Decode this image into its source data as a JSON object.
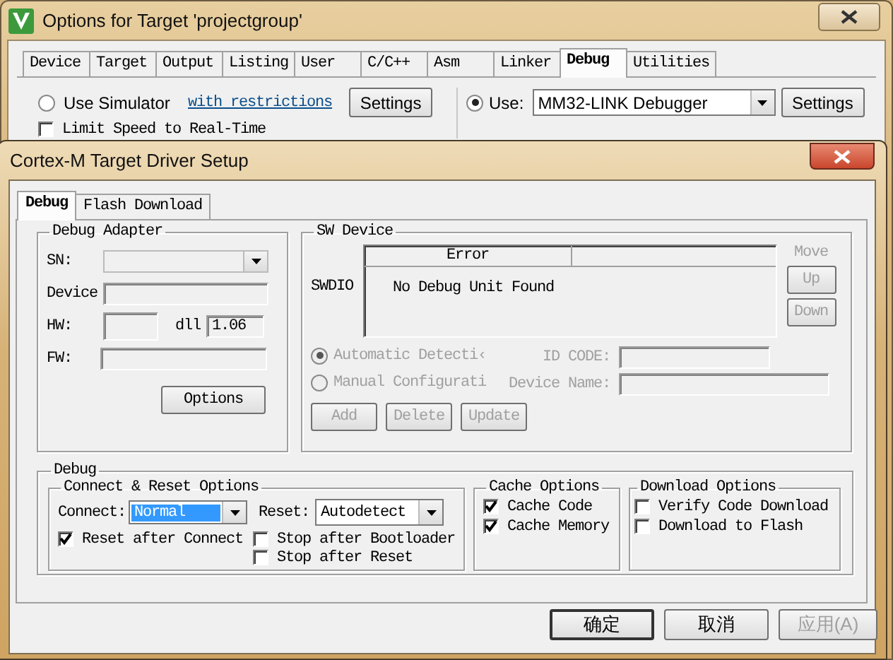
{
  "window": {
    "title": "Options for Target 'projectgroup'"
  },
  "tabs": [
    {
      "label": "Device",
      "selected": false
    },
    {
      "label": "Target",
      "selected": false
    },
    {
      "label": "Output",
      "selected": false
    },
    {
      "label": "Listing",
      "selected": false
    },
    {
      "label": "User",
      "selected": false
    },
    {
      "label": "C/C++",
      "selected": false
    },
    {
      "label": "Asm",
      "selected": false
    },
    {
      "label": "Linker",
      "selected": false
    },
    {
      "label": "Debug",
      "selected": true
    },
    {
      "label": "Utilities",
      "selected": false
    }
  ],
  "simulator": {
    "label": "Use Simulator",
    "selected": false,
    "link": "with restrictions",
    "settings": "Settings",
    "limit_speed": {
      "label": "Limit Speed to Real-Time",
      "checked": false
    }
  },
  "target_debugger": {
    "label": "Use:",
    "selected": true,
    "value": "MM32-LINK Debugger",
    "settings": "Settings"
  },
  "dialog": {
    "title": "Cortex-M Target Driver Setup",
    "tabs": [
      {
        "label": "Debug",
        "selected": true
      },
      {
        "label": "Flash Download",
        "selected": false
      }
    ],
    "debug_adapter": {
      "title": "Debug Adapter",
      "sn": {
        "label": "SN:"
      },
      "device": {
        "label": "Device"
      },
      "hw": {
        "label": "HW:"
      },
      "dll": {
        "label": "dll",
        "value": "1.06"
      },
      "fw": {
        "label": "FW:"
      },
      "options": "Options"
    },
    "sw_device": {
      "title": "SW Device",
      "port": "SWDIO",
      "columns": [
        "Error"
      ],
      "rows": [
        [
          "No Debug Unit Found"
        ]
      ],
      "move": {
        "label": "Move",
        "disabled": true
      },
      "move_buttons": [
        {
          "label": "Up",
          "disabled": true
        },
        {
          "label": "Down",
          "disabled": true
        }
      ],
      "modes": [
        {
          "label": "Automatic Detecti‹",
          "selected": true,
          "disabled": true
        },
        {
          "label": "Manual Configurati",
          "selected": false,
          "disabled": true
        }
      ],
      "id_code": {
        "label": "ID CODE:",
        "disabled": true
      },
      "device_name": {
        "label": "Device Name:",
        "disabled": true
      },
      "actions": [
        {
          "label": "Add",
          "disabled": true
        },
        {
          "label": "Delete",
          "disabled": true
        },
        {
          "label": "Update",
          "disabled": true
        }
      ]
    },
    "debug": {
      "title": "Debug",
      "connect_reset": {
        "title": "Connect & Reset Options",
        "connect": {
          "label": "Connect:",
          "value": "Normal",
          "highlighted": true
        },
        "reset": {
          "label": "Reset:",
          "value": "Autodetect",
          "highlighted": false
        },
        "checks": [
          {
            "label": "Reset after Connect",
            "checked": true
          },
          {
            "label": "Stop after Bootloader",
            "checked": false
          },
          {
            "label": "Stop after Reset",
            "checked": false
          }
        ]
      },
      "cache": {
        "title": "Cache Options",
        "checks": [
          {
            "label": "Cache Code",
            "checked": true
          },
          {
            "label": "Cache Memory",
            "checked": true
          }
        ]
      },
      "download": {
        "title": "Download Options",
        "checks": [
          {
            "label": "Verify Code Download",
            "checked": false
          },
          {
            "label": "Download to Flash",
            "checked": false
          }
        ]
      }
    },
    "buttons": [
      {
        "label": "确定",
        "default": true,
        "disabled": false
      },
      {
        "label": "取消",
        "default": false,
        "disabled": false
      },
      {
        "label": "应用(A)",
        "default": false,
        "disabled": true
      }
    ]
  }
}
